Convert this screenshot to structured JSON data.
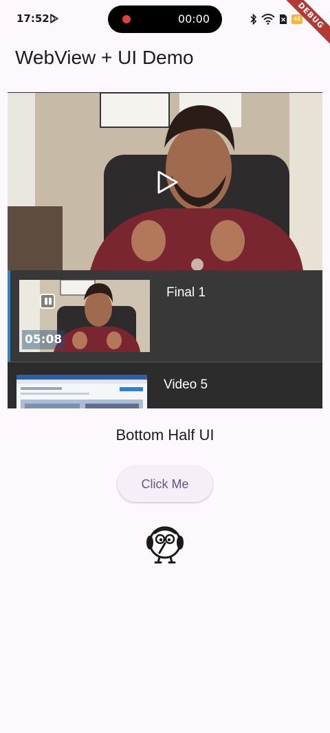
{
  "status_bar": {
    "time": "17:52",
    "recording_time": "00:00",
    "battery_level": "48",
    "debug_label": "DEBUG",
    "icons": [
      "play-store-icon",
      "record-dot-icon",
      "bluetooth-icon",
      "wifi-icon",
      "no-sim-icon",
      "battery-icon"
    ]
  },
  "app_bar": {
    "title": "WebView + UI Demo"
  },
  "webview": {
    "player": {
      "state": "paused",
      "icon": "play-icon"
    },
    "playlist": [
      {
        "title": "Final 1",
        "duration": "05:08",
        "active": true,
        "thumb_icon": "pause-icon"
      },
      {
        "title": "Video 5",
        "active": false
      }
    ]
  },
  "bottom": {
    "label": "Bottom Half UI",
    "button_label": "Click Me",
    "mascot_icon": "bird-mascot-icon"
  },
  "colors": {
    "background": "#fdf7fe",
    "button_text": "#65558f",
    "playlist_accent": "#2b83d6",
    "debug_ribbon": "#b13a35"
  }
}
